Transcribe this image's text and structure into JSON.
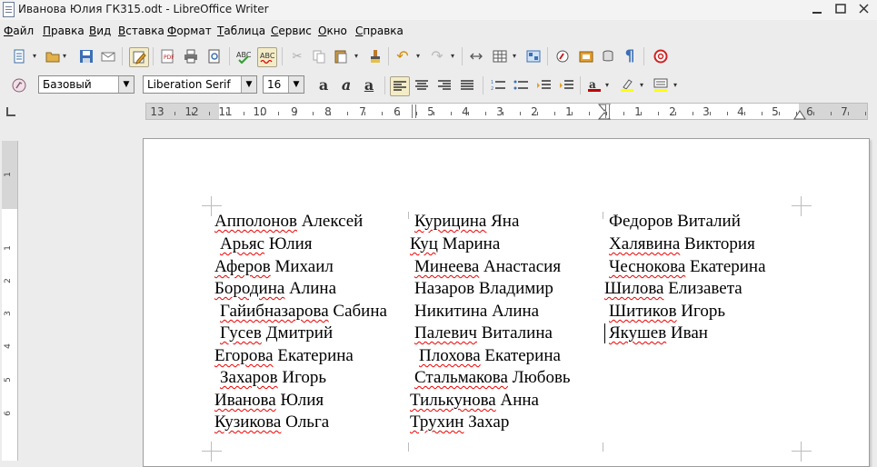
{
  "window": {
    "title": "Иванова Юлия ГК315.odt - LibreOffice Writer"
  },
  "menu": [
    {
      "label": "Файл",
      "u": "Ф",
      "rest": "айл"
    },
    {
      "label": "Правка",
      "u": "П",
      "rest": "равка"
    },
    {
      "label": "Вид",
      "u": "В",
      "rest": "ид"
    },
    {
      "label": "Вставка",
      "u": "В",
      "rest": "ставка"
    },
    {
      "label": "Формат",
      "u": "Ф",
      "rest": "ормат"
    },
    {
      "label": "Таблица",
      "u": "Т",
      "rest": "аблица"
    },
    {
      "label": "Сервис",
      "u": "С",
      "rest": "ервис"
    },
    {
      "label": "Окно",
      "u": "О",
      "rest": "кно"
    },
    {
      "label": "Справка",
      "u": "С",
      "rest": "правка"
    }
  ],
  "formatting": {
    "paragraph_style": "Базовый",
    "font_name": "Liberation Serif",
    "font_size": "16"
  },
  "ruler": {
    "labels": [
      "13",
      "12",
      "11",
      "10",
      "9",
      "8",
      "7",
      "6",
      "5",
      "4",
      "3",
      "2",
      "1",
      "1",
      "2",
      "3",
      "4",
      "5",
      "6",
      "7"
    ]
  },
  "vruler": {
    "labels": [
      "1",
      "1",
      "2",
      "3",
      "4",
      "5",
      "6"
    ]
  },
  "document": {
    "columns": [
      {
        "names": [
          {
            "sq": "Апполонов",
            "rest": " Алексей"
          },
          {
            "sq": "Арьяс",
            "rest": " Юлия"
          },
          {
            "sq": "Аферов",
            "rest": " Михаил"
          },
          {
            "sq": "Бородина",
            "rest": " Алина"
          },
          {
            "sq": "Гайибназарова",
            "rest": " Сабина"
          },
          {
            "sq": "Гусев",
            "rest": " Дмитрий"
          },
          {
            "sq": "Егорова",
            "rest": " Екатерина"
          },
          {
            "sq": "Захаров",
            "rest": " Игорь"
          },
          {
            "sq": "Иванова",
            "rest": " Юлия"
          },
          {
            "sq": "Кузикова",
            "rest": " Ольга"
          }
        ]
      },
      {
        "names": [
          {
            "sq": "Курицина",
            "rest": " Яна"
          },
          {
            "sq": "Куц",
            "rest": " Марина"
          },
          {
            "sq": "Минеева",
            "rest": " Анастасия"
          },
          {
            "sq": "",
            "rest": "Назаров Владимир"
          },
          {
            "sq": "",
            "rest": "Никитина Алина"
          },
          {
            "sq": "Палевич",
            "rest": " Виталина"
          },
          {
            "sq": "Плохова",
            "rest": " Екатерина"
          },
          {
            "sq": "Стальмакова",
            "rest": " Любовь"
          },
          {
            "sq": "Тилькунова",
            "rest": " Анна"
          },
          {
            "sq": "Трухин",
            "rest": " Захар"
          }
        ]
      },
      {
        "names": [
          {
            "sq": "",
            "rest": "Федоров Виталий"
          },
          {
            "sq": "Халявина",
            "rest": " Виктория"
          },
          {
            "sq": "Чеснокова",
            "rest": " Екатерина"
          },
          {
            "sq": "Шилова",
            "rest": " Елизавета"
          },
          {
            "sq": "Шитиков",
            "rest": " Игорь"
          },
          {
            "sq": "Якушев",
            "rest": " Иван"
          }
        ]
      }
    ]
  }
}
